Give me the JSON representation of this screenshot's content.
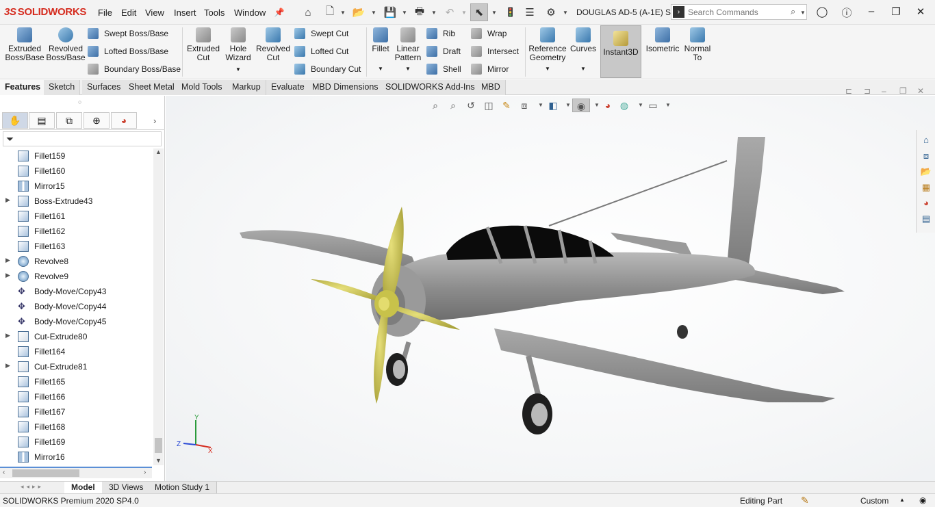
{
  "app": {
    "logo": "SOLIDWORKS",
    "doc_title": "DOUGLAS AD-5 (A-1E) S..."
  },
  "menu": [
    "File",
    "Edit",
    "View",
    "Insert",
    "Tools",
    "Window"
  ],
  "search": {
    "placeholder": "Search Commands"
  },
  "ribbon": {
    "extruded_boss": "Extruded Boss/Base",
    "revolved_boss": "Revolved Boss/Base",
    "swept_boss": "Swept Boss/Base",
    "lofted_boss": "Lofted Boss/Base",
    "boundary_boss": "Boundary Boss/Base",
    "extruded_cut": "Extruded Cut",
    "hole_wizard": "Hole Wizard",
    "revolved_cut": "Revolved Cut",
    "swept_cut": "Swept Cut",
    "lofted_cut": "Lofted Cut",
    "boundary_cut": "Boundary Cut",
    "fillet": "Fillet",
    "linear_pattern": "Linear Pattern",
    "rib": "Rib",
    "draft": "Draft",
    "shell": "Shell",
    "wrap": "Wrap",
    "intersect": "Intersect",
    "mirror": "Mirror",
    "reference_geometry": "Reference Geometry",
    "curves": "Curves",
    "instant3d": "Instant3D",
    "isometric": "Isometric",
    "normal_to": "Normal To"
  },
  "tabs": [
    "Features",
    "Sketch",
    "Surfaces",
    "Sheet Metal",
    "Mold Tools",
    "Markup",
    "Evaluate",
    "MBD Dimensions",
    "SOLIDWORKS Add-Ins",
    "MBD"
  ],
  "tree": [
    {
      "label": "Fillet159",
      "kind": "fillet",
      "expandable": false
    },
    {
      "label": "Fillet160",
      "kind": "fillet",
      "expandable": false
    },
    {
      "label": "Mirror15",
      "kind": "mirror",
      "expandable": false
    },
    {
      "label": "Boss-Extrude43",
      "kind": "boss",
      "expandable": true
    },
    {
      "label": "Fillet161",
      "kind": "fillet",
      "expandable": false
    },
    {
      "label": "Fillet162",
      "kind": "fillet",
      "expandable": false
    },
    {
      "label": "Fillet163",
      "kind": "fillet",
      "expandable": false
    },
    {
      "label": "Revolve8",
      "kind": "revolve",
      "expandable": true
    },
    {
      "label": "Revolve9",
      "kind": "revolve",
      "expandable": true
    },
    {
      "label": "Body-Move/Copy43",
      "kind": "move",
      "expandable": false
    },
    {
      "label": "Body-Move/Copy44",
      "kind": "move",
      "expandable": false
    },
    {
      "label": "Body-Move/Copy45",
      "kind": "move",
      "expandable": false
    },
    {
      "label": "Cut-Extrude80",
      "kind": "cut",
      "expandable": true
    },
    {
      "label": "Fillet164",
      "kind": "fillet",
      "expandable": false
    },
    {
      "label": "Cut-Extrude81",
      "kind": "cut",
      "expandable": true
    },
    {
      "label": "Fillet165",
      "kind": "fillet",
      "expandable": false
    },
    {
      "label": "Fillet166",
      "kind": "fillet",
      "expandable": false
    },
    {
      "label": "Fillet167",
      "kind": "fillet",
      "expandable": false
    },
    {
      "label": "Fillet168",
      "kind": "fillet",
      "expandable": false
    },
    {
      "label": "Fillet169",
      "kind": "fillet",
      "expandable": false
    },
    {
      "label": "Mirror16",
      "kind": "mirror",
      "expandable": false
    }
  ],
  "axes": {
    "x": "X",
    "y": "Y",
    "z": "Z"
  },
  "bottom_tabs": [
    "Model",
    "3D Views",
    "Motion Study 1"
  ],
  "status": {
    "version": "SOLIDWORKS Premium 2020 SP4.0",
    "mode": "Editing Part",
    "units": "Custom"
  },
  "colors": {
    "model_grey": "#8e8e8e",
    "propeller": "#c8c24a",
    "accent_red": "#d52b1e"
  }
}
